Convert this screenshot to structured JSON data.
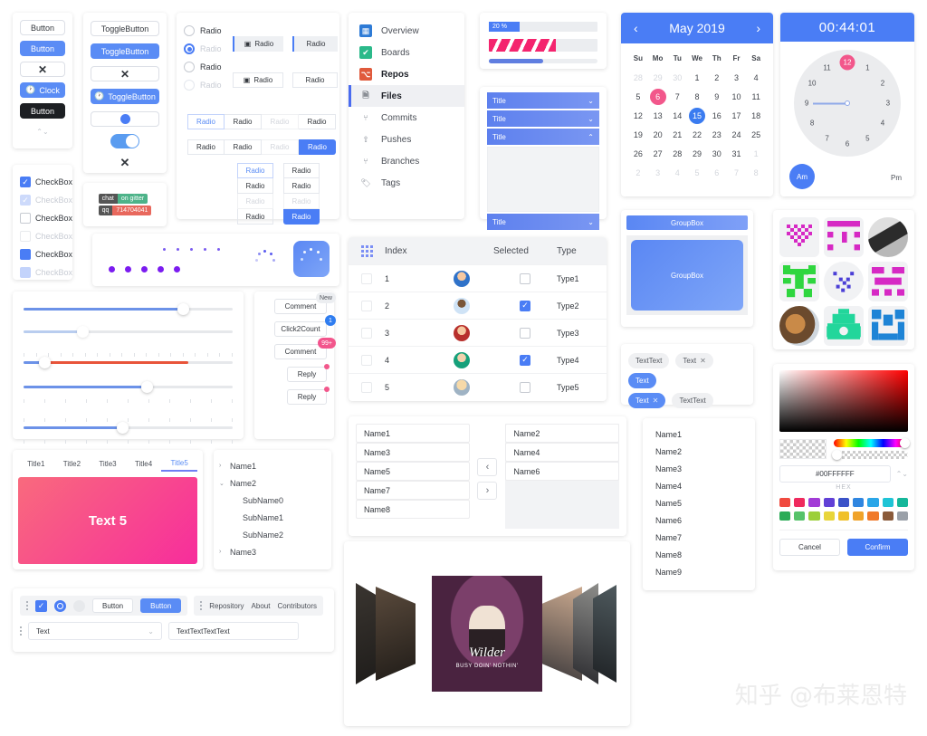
{
  "buttons_card": {
    "items": [
      {
        "label": "Button",
        "style": "default"
      },
      {
        "label": "Button",
        "style": "primary"
      },
      {
        "label": "✕",
        "style": "icon"
      },
      {
        "label": "Clock",
        "style": "primary-icon"
      },
      {
        "label": "Button",
        "style": "dark"
      },
      {
        "label": "⌃⌄",
        "style": "spinner"
      }
    ]
  },
  "toggle_card": {
    "items": [
      {
        "label": "ToggleButton",
        "style": "default"
      },
      {
        "label": "ToggleButton",
        "style": "primary"
      },
      {
        "label": "✕",
        "style": "icon"
      },
      {
        "label": "ToggleButton",
        "style": "primary-icon"
      },
      {
        "label": "",
        "style": "knob"
      },
      {
        "label": "",
        "style": "switch"
      },
      {
        "label": "✕",
        "style": "plain-icon"
      }
    ]
  },
  "checkbox_card": {
    "items": [
      {
        "label": "CheckBox",
        "state": "checked"
      },
      {
        "label": "CheckBox",
        "state": "checked-disabled"
      },
      {
        "label": "CheckBox",
        "state": "unchecked"
      },
      {
        "label": "CheckBox",
        "state": "unchecked-disabled"
      },
      {
        "label": "CheckBox",
        "state": "partial"
      },
      {
        "label": "CheckBox",
        "state": "partial-disabled"
      }
    ]
  },
  "chat_badges": [
    {
      "left": "chat",
      "right": "on gitter",
      "color": "#4db389"
    },
    {
      "left": "qq",
      "right": "714704041",
      "color": "#e8685d"
    }
  ],
  "radios_card": {
    "plain": [
      {
        "label": "Radio",
        "state": "off"
      },
      {
        "label": "Radio",
        "state": "on-disabled"
      },
      {
        "label": "Radio",
        "state": "off"
      },
      {
        "label": "Radio",
        "state": "off-disabled"
      }
    ],
    "icon_group": [
      {
        "label": "Radio",
        "icon": "calendar-icon",
        "state": "selected"
      },
      {
        "label": "Radio",
        "icon": "",
        "state": "normal"
      },
      {
        "label": "Radio",
        "icon": "calendar-icon",
        "state": "normal"
      },
      {
        "label": "Radio",
        "icon": "",
        "state": "normal"
      }
    ],
    "row_a": [
      {
        "label": "Radio",
        "state": "selected"
      },
      {
        "label": "Radio",
        "state": "normal"
      },
      {
        "label": "Radio",
        "state": "disabled"
      },
      {
        "label": "Radio",
        "state": "normal"
      }
    ],
    "row_b": [
      {
        "label": "Radio",
        "state": "normal"
      },
      {
        "label": "Radio",
        "state": "normal"
      },
      {
        "label": "Radio",
        "state": "disabled"
      },
      {
        "label": "Radio",
        "state": "filled"
      }
    ],
    "col_a": [
      {
        "label": "Radio",
        "state": "selected"
      },
      {
        "label": "Radio",
        "state": "normal"
      },
      {
        "label": "Radio",
        "state": "disabled"
      },
      {
        "label": "Radio",
        "state": "normal"
      }
    ],
    "col_b": [
      {
        "label": "Radio",
        "state": "normal"
      },
      {
        "label": "Radio",
        "state": "normal"
      },
      {
        "label": "Radio",
        "state": "disabled"
      },
      {
        "label": "Radio",
        "state": "filled"
      }
    ]
  },
  "nav": {
    "items": [
      {
        "label": "Overview",
        "icon": "overview-icon",
        "color": "#2e7bd6",
        "state": "normal"
      },
      {
        "label": "Boards",
        "icon": "boards-icon",
        "color": "#2bb98a",
        "state": "normal"
      },
      {
        "label": "Repos",
        "icon": "repos-icon",
        "color": "#e05a3c",
        "state": "bold"
      },
      {
        "label": "Files",
        "icon": "files-icon",
        "color": "#8b9099",
        "state": "selected"
      },
      {
        "label": "Commits",
        "icon": "commits-icon",
        "color": "#8b9099",
        "state": "normal"
      },
      {
        "label": "Pushes",
        "icon": "pushes-icon",
        "color": "#8b9099",
        "state": "normal"
      },
      {
        "label": "Branches",
        "icon": "branches-icon",
        "color": "#8b9099",
        "state": "normal"
      },
      {
        "label": "Tags",
        "icon": "tags-icon",
        "color": "#8b9099",
        "state": "normal"
      }
    ]
  },
  "progress": {
    "labeled_value": "20 %",
    "labeled_pct": 28,
    "stripe_pct": 62,
    "thin_pct": 50
  },
  "accordion": {
    "headers": [
      "Title",
      "Title",
      "Title",
      "Title"
    ],
    "expanded_index": 2
  },
  "calendar": {
    "title": "May 2019",
    "prev_icon": "chevron-left-icon",
    "next_icon": "chevron-right-icon",
    "dow": [
      "Su",
      "Mo",
      "Tu",
      "We",
      "Th",
      "Fr",
      "Sa"
    ],
    "weeks": [
      [
        {
          "d": "28",
          "out": true
        },
        {
          "d": "29",
          "out": true
        },
        {
          "d": "30",
          "out": true
        },
        {
          "d": "1"
        },
        {
          "d": "2"
        },
        {
          "d": "3"
        },
        {
          "d": "4"
        }
      ],
      [
        {
          "d": "5"
        },
        {
          "d": "6",
          "mark": "pink"
        },
        {
          "d": "7"
        },
        {
          "d": "8"
        },
        {
          "d": "9"
        },
        {
          "d": "10"
        },
        {
          "d": "11"
        }
      ],
      [
        {
          "d": "12"
        },
        {
          "d": "13"
        },
        {
          "d": "14"
        },
        {
          "d": "15",
          "mark": "blue"
        },
        {
          "d": "16"
        },
        {
          "d": "17"
        },
        {
          "d": "18"
        }
      ],
      [
        {
          "d": "19"
        },
        {
          "d": "20"
        },
        {
          "d": "21"
        },
        {
          "d": "22"
        },
        {
          "d": "23"
        },
        {
          "d": "24"
        },
        {
          "d": "25"
        }
      ],
      [
        {
          "d": "26"
        },
        {
          "d": "27"
        },
        {
          "d": "28"
        },
        {
          "d": "29"
        },
        {
          "d": "30"
        },
        {
          "d": "31"
        },
        {
          "d": "1",
          "out": true
        }
      ],
      [
        {
          "d": "2",
          "out": true
        },
        {
          "d": "3",
          "out": true
        },
        {
          "d": "4",
          "out": true
        },
        {
          "d": "5",
          "out": true
        },
        {
          "d": "6",
          "out": true
        },
        {
          "d": "7",
          "out": true
        },
        {
          "d": "8",
          "out": true
        }
      ]
    ]
  },
  "clock": {
    "time": "00:44:01",
    "numbers": [
      "12",
      "1",
      "2",
      "3",
      "4",
      "5",
      "6",
      "7",
      "8",
      "9",
      "10",
      "11"
    ],
    "highlighted": "12",
    "am_label": "Am",
    "pm_label": "Pm",
    "am_selected": true
  },
  "table": {
    "columns": [
      "",
      "Index",
      "",
      "Selected",
      "Type"
    ],
    "header_icon": "grid-icon",
    "rows": [
      {
        "index": "1",
        "selected": false,
        "type": "Type1",
        "avatar": "#2f72c9"
      },
      {
        "index": "2",
        "selected": true,
        "type": "Type2",
        "avatar": "#cfe3f6"
      },
      {
        "index": "3",
        "selected": false,
        "type": "Type3",
        "avatar": "#b8302c"
      },
      {
        "index": "4",
        "selected": true,
        "type": "Type4",
        "avatar": "#16a07a"
      },
      {
        "index": "5",
        "selected": false,
        "type": "Type5",
        "avatar": "#e8a95a"
      }
    ]
  },
  "groupbox": {
    "title": "GroupBox",
    "body_label": "GroupBox"
  },
  "tags": [
    {
      "label": "TextText",
      "style": "grey",
      "closable": false
    },
    {
      "label": "Text",
      "style": "grey",
      "closable": true
    },
    {
      "label": "Text",
      "style": "blue",
      "closable": false
    },
    {
      "label": "Text",
      "style": "blue",
      "closable": true
    },
    {
      "label": "TextText",
      "style": "grey",
      "closable": false
    }
  ],
  "identicons": [
    {
      "kind": "identicon",
      "color": "#d629c4",
      "shape": "heart"
    },
    {
      "kind": "identicon",
      "color": "#d629c4",
      "shape": "blocks"
    },
    {
      "kind": "photo",
      "color": "#8a8a88",
      "shape": "photo-motorcycle"
    },
    {
      "kind": "identicon",
      "color": "#2fd63f",
      "shape": "creature"
    },
    {
      "kind": "identicon-circle",
      "color": "#4b3fd6",
      "shape": "dots"
    },
    {
      "kind": "identicon",
      "color": "#d629c4",
      "shape": "bars"
    },
    {
      "kind": "photo-circle",
      "color": "#9b7a52",
      "shape": "photo-fox"
    },
    {
      "kind": "identicon",
      "color": "#22d69b",
      "shape": "robot"
    },
    {
      "kind": "identicon",
      "color": "#1e84d6",
      "shape": "glyph"
    }
  ],
  "sliders": [
    {
      "value": 76,
      "style": "plain"
    },
    {
      "value": 28,
      "style": "disabled"
    },
    {
      "value": 10,
      "style": "range-red",
      "range_end": 79
    },
    {
      "value": 59,
      "style": "ticks-below"
    },
    {
      "value": 47,
      "style": "ticks-both"
    }
  ],
  "comment_badges": [
    {
      "label": "Comment",
      "badge": "New",
      "badge_style": "grey"
    },
    {
      "label": "Click2Count",
      "badge": "1",
      "badge_style": "blue"
    },
    {
      "label": "Comment",
      "badge": "99+",
      "badge_style": "pink"
    },
    {
      "label": "Reply",
      "badge": "",
      "badge_style": "dot"
    },
    {
      "label": "Reply",
      "badge": "",
      "badge_style": "dot"
    }
  ],
  "transfer": {
    "left": [
      "Name1",
      "Name3",
      "Name5",
      "Name7",
      "Name8"
    ],
    "right": [
      "Name2",
      "Name4",
      "Name6"
    ],
    "move_left_icon": "chevron-left-icon",
    "move_right_icon": "chevron-right-icon"
  },
  "namelist": [
    "Name1",
    "Name2",
    "Name3",
    "Name4",
    "Name5",
    "Name6",
    "Name7",
    "Name8",
    "Name9"
  ],
  "tabs": {
    "labels": [
      "Title1",
      "Title2",
      "Title3",
      "Title4",
      "Title5"
    ],
    "active_index": 4,
    "panel_text": "Text 5"
  },
  "tree": [
    {
      "label": "Name1",
      "level": 0,
      "chevron": "›"
    },
    {
      "label": "Name2",
      "level": 0,
      "chevron": "⌄"
    },
    {
      "label": "SubName0",
      "level": 1,
      "chevron": ""
    },
    {
      "label": "SubName1",
      "level": 1,
      "chevron": ""
    },
    {
      "label": "SubName2",
      "level": 1,
      "chevron": ""
    },
    {
      "label": "Name3",
      "level": 0,
      "chevron": "›"
    }
  ],
  "toolbar": {
    "buttons": [
      "Button",
      "Button"
    ],
    "links": [
      "Repository",
      "About",
      "Contributors"
    ],
    "select_value": "Text",
    "input_value": "TextTextTextText",
    "dropdown_icon": "chevron-down-icon",
    "grip_icon": "grip-icon"
  },
  "carousel": {
    "center_title": "Wilder",
    "center_subtitle": "BUSY DOIN' NOTHIN'"
  },
  "colorpicker": {
    "hex_value": "#00FFFFFF",
    "hex_label": "HEX",
    "cancel_label": "Cancel",
    "confirm_label": "Confirm",
    "swatch_row1": [
      "#f04a3f",
      "#ef2a5e",
      "#a23bd6",
      "#6140d6",
      "#3a52c8",
      "#2f86e0",
      "#2aa6e8",
      "#1fc4d6",
      "#15b79a"
    ],
    "swatch_row2": [
      "#2aab56",
      "#56c36a",
      "#9ccf3a",
      "#e8d53a",
      "#f0c02a",
      "#f0a32a",
      "#f07a2a",
      "#8a5a3a",
      "#9aa0a8"
    ]
  },
  "watermark": "知乎 @布莱恩特"
}
